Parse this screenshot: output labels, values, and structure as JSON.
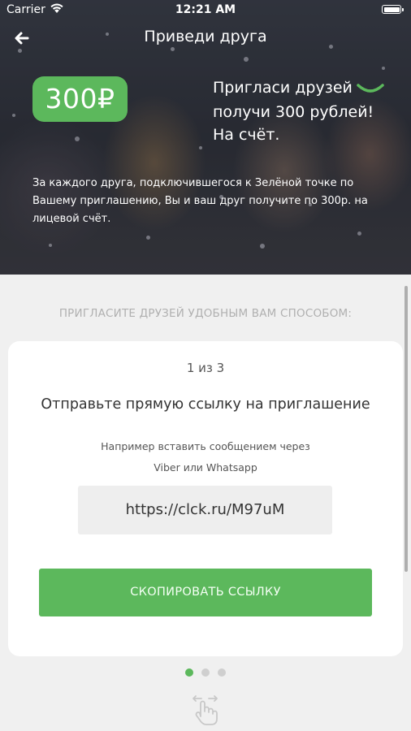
{
  "status_bar": {
    "carrier": "Carrier",
    "time": "12:21 AM"
  },
  "nav": {
    "title": "Приведи друга",
    "back_icon": "arrow-left-icon"
  },
  "hero": {
    "price": "300₽",
    "promo_line1": "Пригласи друзей",
    "promo_line2": "получи 300 рублей!",
    "promo_line3": "На счёт.",
    "description": "За каждого друга, подключившегося к Зелёной точке по Вашему приглашению, Вы и ваш друг получите по 300р. на лицевой счёт."
  },
  "invite_caption": "ПРИГЛАСИТЕ ДРУЗЕЙ УДОБНЫМ ВАМ СПОСОБОМ:",
  "card": {
    "step": "1 из 3",
    "heading": "Отправьте прямую ссылку на приглашение",
    "hint_line1": "Например вставить сообщением через",
    "hint_line2": "Viber или Whatsapp",
    "link": "https://clck.ru/M97uM",
    "copy_button": "СКОПИРОВАТЬ ССЫЛКУ"
  },
  "pager": {
    "total": 3,
    "active_index": 0
  },
  "colors": {
    "accent_green": "#5cb85c",
    "background": "#f0f0f0"
  }
}
